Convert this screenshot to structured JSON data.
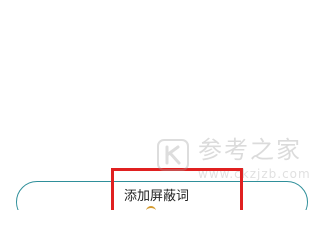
{
  "screen": {
    "add_button": {
      "label": "添加屏蔽词"
    },
    "watermark": {
      "title": "参考之家",
      "url": "www.ckzjzb.com"
    }
  },
  "colors": {
    "button_border": "#2f8f9a",
    "highlight_border": "#e02020",
    "watermark_gray": "#9a9a9a"
  }
}
